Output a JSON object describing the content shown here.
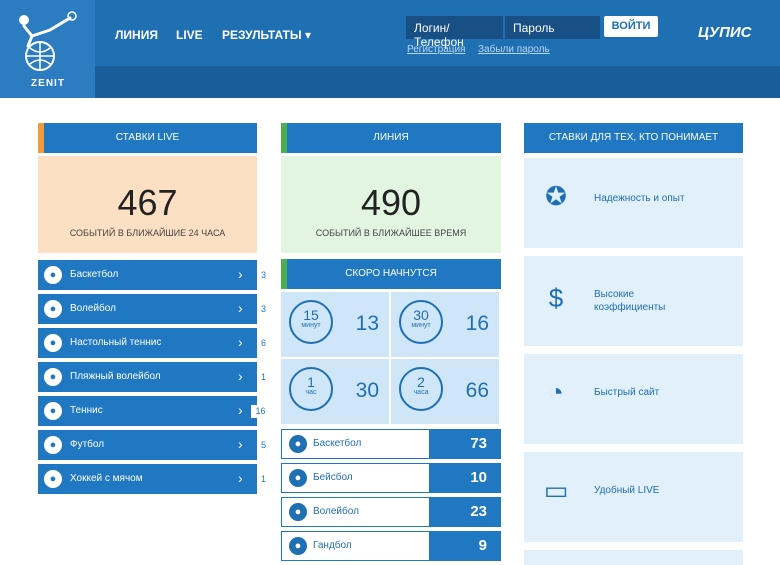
{
  "header": {
    "logo_text": "ZENIT",
    "nav": [
      "ЛИНИЯ",
      "LIVE",
      "РЕЗУЛЬТАТЫ ▾"
    ],
    "login_placeholder": "Логин/Телефон",
    "password_placeholder": "Пароль",
    "login_button": "ВОЙТИ",
    "register": "Регистрация",
    "forgot": "Забыли пароль",
    "cupis": "ЦУПИС"
  },
  "live": {
    "title": "СТАВКИ LIVE",
    "count": "467",
    "subtitle": "СОБЫТИЙ В БЛИЖАЙШИЕ 24 ЧАСА",
    "sports": [
      {
        "label": "Баскетбол",
        "count": "3",
        "icon": "basketball-icon"
      },
      {
        "label": "Волейбол",
        "count": "3",
        "icon": "volleyball-icon"
      },
      {
        "label": "Настольный теннис",
        "count": "6",
        "icon": "table-tennis-icon"
      },
      {
        "label": "Пляжный волейбол",
        "count": "1",
        "icon": "volleyball-icon"
      },
      {
        "label": "Теннис",
        "count": "16",
        "icon": "tennis-icon"
      },
      {
        "label": "Футбол",
        "count": "5",
        "icon": "football-icon"
      },
      {
        "label": "Хоккей с мячом",
        "count": "1",
        "icon": "hockey-ball-icon"
      }
    ]
  },
  "line": {
    "title": "ЛИНИЯ",
    "count": "490",
    "subtitle": "СОБЫТИЙ В БЛИЖАЙШЕЕ ВРЕМЯ",
    "soon_title": "СКОРО НАЧНУТСЯ",
    "timers": [
      {
        "n": "15",
        "unit": "минут",
        "value": "13"
      },
      {
        "n": "30",
        "unit": "минут",
        "value": "16"
      },
      {
        "n": "1",
        "unit": "час",
        "value": "30"
      },
      {
        "n": "2",
        "unit": "часа",
        "value": "66"
      }
    ],
    "sports": [
      {
        "label": "Баскетбол",
        "value": "73"
      },
      {
        "label": "Бейсбол",
        "value": "10"
      },
      {
        "label": "Волейбол",
        "value": "23"
      },
      {
        "label": "Гандбол",
        "value": "9"
      }
    ]
  },
  "features": {
    "title": "СТАВКИ ДЛЯ ТЕХ, КТО ПОНИМАЕТ",
    "items": [
      {
        "text": "Надежность и опыт",
        "icon": "medal-icon"
      },
      {
        "text": "Высокие коэффициенты",
        "icon": "money-bag-icon"
      },
      {
        "text": "Быстрый сайт",
        "icon": "speedometer-icon"
      },
      {
        "text": "Удобный LIVE",
        "icon": "monitor-chart-icon"
      }
    ]
  },
  "colors": {
    "primary": "#1f78c1",
    "header": "#1f6fb3",
    "live_bg": "#fde0c4",
    "line_bg": "#e1f5e1",
    "feature_bg": "#e2f0fb"
  }
}
